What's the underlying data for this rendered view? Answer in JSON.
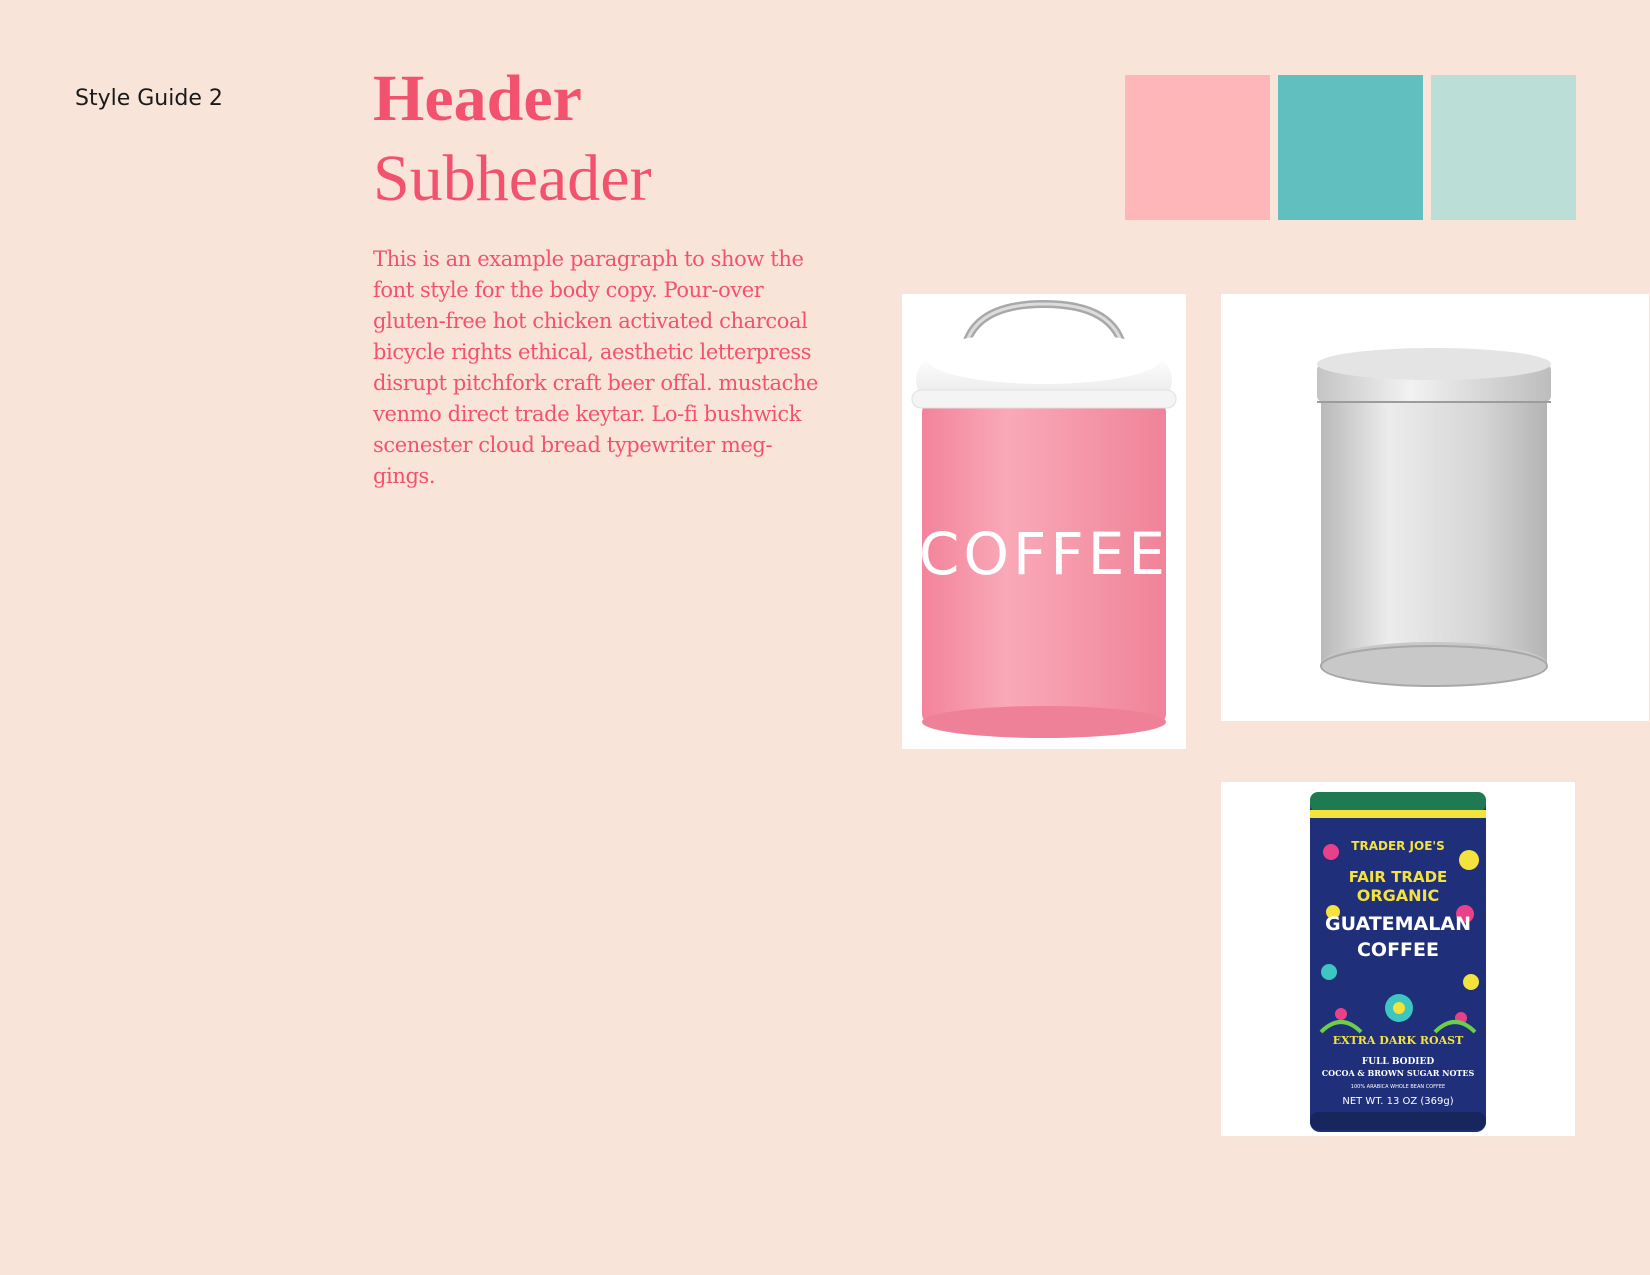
{
  "page": {
    "label": "Style Guide 2"
  },
  "typography": {
    "header": "Header",
    "subheader": "Subheader",
    "body": "This is an example paragraph to show the font style for the body copy. Pour-over gluten-free hot chicken activated charcoal bicycle rights ethical, aesthetic letterpress disrupt pitchfork craft beer offal. mustache venmo direct trade keytar. Lo-fi bushwick scenester cloud bread typewriter meg-gings."
  },
  "palette": [
    "#ffb6b9",
    "#61c0bf",
    "#bbded6"
  ],
  "images": {
    "pink_canister": {
      "text": "COFFEE"
    },
    "silver_tin": {},
    "coffee_can": {
      "brand": "TRADER JOE'S",
      "line1": "FAIR TRADE",
      "line2": "ORGANIC",
      "line3": "GUATEMALAN",
      "line4": "COFFEE",
      "roast": "EXTRA DARK ROAST",
      "notes1": "FULL BODIED",
      "notes2": "COCOA & BROWN SUGAR NOTES",
      "fine": "100% ARABICA WHOLE BEAN COFFEE",
      "weight": "NET WT. 13 OZ (369g)"
    }
  }
}
